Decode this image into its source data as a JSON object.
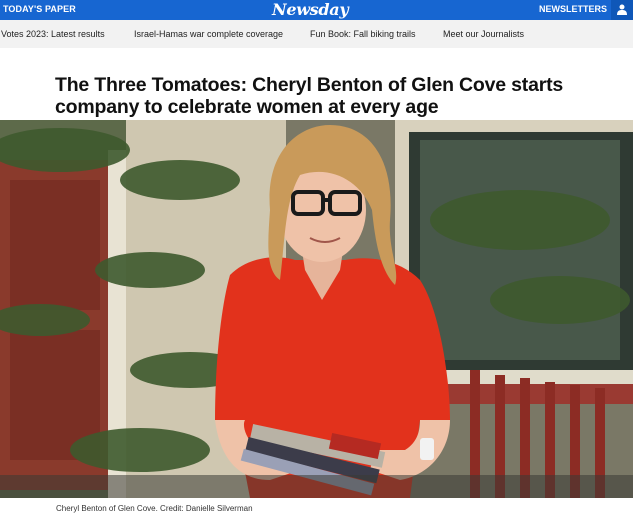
{
  "topbar": {
    "todays_paper": "TODAY'S PAPER",
    "logo": "Newsday",
    "newsletters": "NEWSLETTERS",
    "user_icon": "user-icon"
  },
  "nav": {
    "items": [
      {
        "label": "Votes 2023: Latest results"
      },
      {
        "label": "Israel-Hamas war complete coverage"
      },
      {
        "label": "Fun Book: Fall biking trails"
      },
      {
        "label": "Meet our Journalists"
      }
    ]
  },
  "article": {
    "headline": "The Three Tomatoes: Cheryl Benton of Glen Cove starts company to celebrate women at every age",
    "caption": "Cheryl Benton of Glen Cove. Credit: Danielle Silverman"
  },
  "colors": {
    "brand_blue": "#1766d1",
    "nav_bg": "#f2f2f2"
  }
}
